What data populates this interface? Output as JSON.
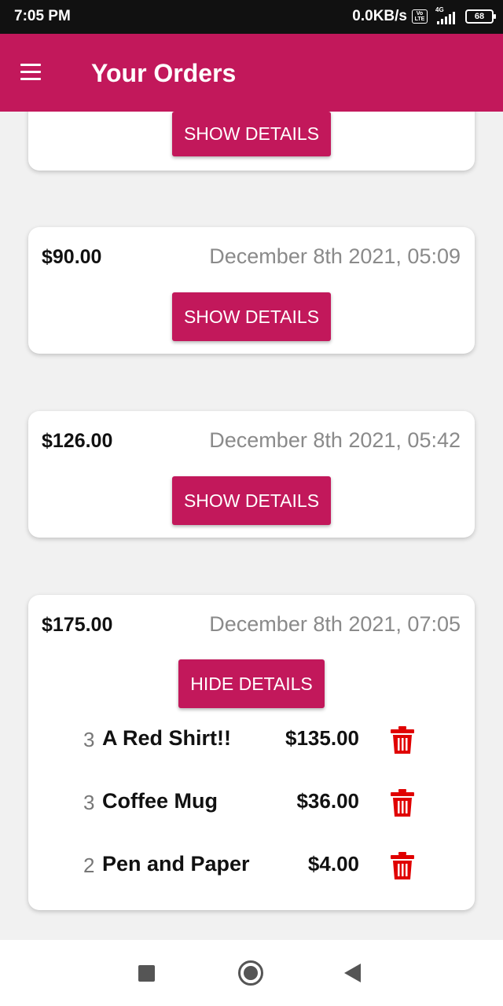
{
  "status_bar": {
    "time": "7:05 PM",
    "net_speed": "0.0KB/s",
    "volte_label": "Vo LTE",
    "network_type": "4G",
    "battery": "68"
  },
  "app_bar": {
    "title": "Your Orders",
    "color": "#c2185b"
  },
  "orders": [
    {
      "amount": "",
      "date": "",
      "button": "SHOW DETAILS"
    },
    {
      "amount": "$90.00",
      "date": "December 8th 2021, 05:09",
      "button": "SHOW DETAILS"
    },
    {
      "amount": "$126.00",
      "date": "December 8th 2021, 05:42",
      "button": "SHOW DETAILS"
    },
    {
      "amount": "$175.00",
      "date": "December 8th 2021, 07:05",
      "button": "HIDE DETAILS",
      "items": [
        {
          "qty": "3",
          "name": "A Red Shirt!!",
          "price": "$135.00"
        },
        {
          "qty": "3",
          "name": "Coffee Mug",
          "price": "$36.00"
        },
        {
          "qty": "2",
          "name": "Pen and Paper",
          "price": "$4.00"
        }
      ]
    }
  ],
  "icons": {
    "menu": "hamburger-menu-icon",
    "delete": "trash-icon",
    "nav_recent": "square-icon",
    "nav_home": "circle-icon",
    "nav_back": "triangle-back-icon"
  },
  "colors": {
    "accent": "#c2185b",
    "delete": "#e00000",
    "date_text": "#8a8a8a"
  }
}
